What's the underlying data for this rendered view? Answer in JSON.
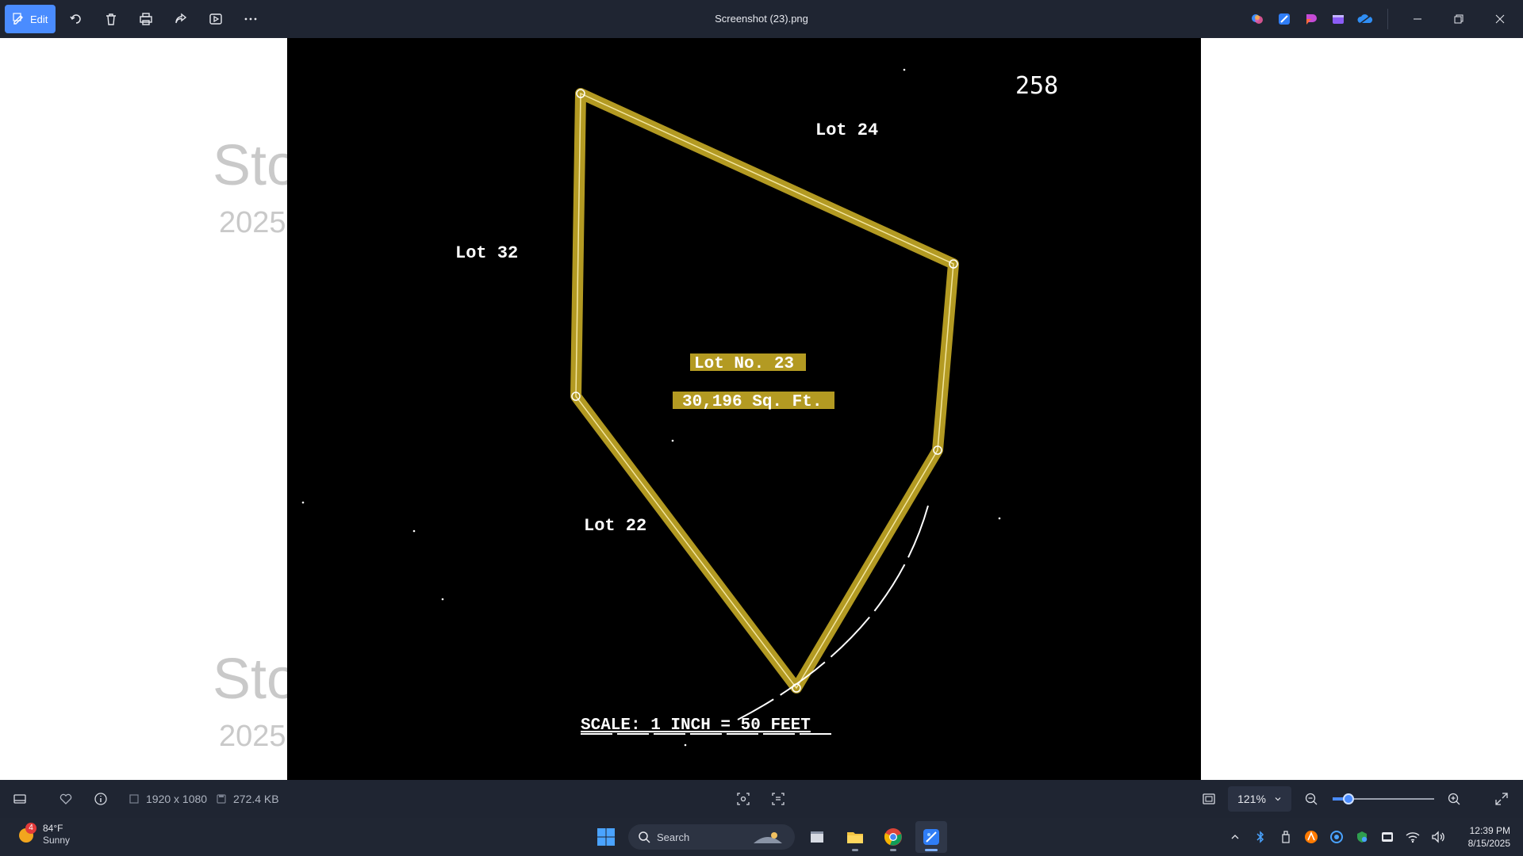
{
  "titlebar": {
    "edit_label": "Edit",
    "title": "Screenshot (23).png",
    "icons": [
      "rotate-icon",
      "delete-icon",
      "print-icon",
      "share-icon",
      "slideshow-icon",
      "more-icon"
    ],
    "apps": [
      "copilot-icon",
      "designer-icon",
      "clipchamp-icon",
      "movie-icon",
      "onedrive-icon"
    ]
  },
  "watermark": {
    "text1": "Sto",
    "text2": "2025"
  },
  "plat": {
    "page_number": "258",
    "lot24": "Lot 24",
    "lot32": "Lot 32",
    "lot22": "Lot 22",
    "lot_no": "Lot No. 23",
    "area": "30,196 Sq. Ft.",
    "scale": "SCALE: 1 INCH = 50 FEET",
    "line_color": "#b39a22"
  },
  "bottombar": {
    "dimensions": "1920 x 1080",
    "file_size": "272.4 KB",
    "zoom": "121%",
    "zoom_level": 0.16
  },
  "taskbar": {
    "weather_badge": "4",
    "temperature": "84°F",
    "condition": "Sunny",
    "search_placeholder": "Search",
    "time": "12:39 PM",
    "date": "8/15/2025"
  }
}
